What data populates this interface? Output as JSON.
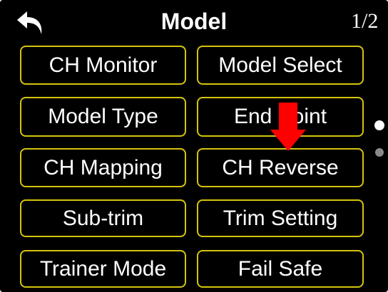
{
  "header": {
    "title": "Model",
    "page_indicator": "1/2",
    "back_icon": "back-arrow-icon"
  },
  "menu": {
    "items": [
      {
        "label": "CH Monitor"
      },
      {
        "label": "Model Select"
      },
      {
        "label": "Model Type"
      },
      {
        "label": "End Point"
      },
      {
        "label": "CH Mapping"
      },
      {
        "label": "CH Reverse"
      },
      {
        "label": "Sub-trim"
      },
      {
        "label": "Trim Setting"
      },
      {
        "label": "Trainer Mode"
      },
      {
        "label": "Fail Safe"
      }
    ]
  },
  "pagination": {
    "current_page": 1,
    "total_pages": 2
  },
  "annotation": {
    "type": "red-down-arrow-icon",
    "target": "CH Reverse"
  },
  "colors": {
    "background": "#000000",
    "button_border": "#d4c40c",
    "text": "#ffffff",
    "annotation": "#ff0000",
    "dot_active": "#ffffff",
    "dot_inactive": "#8a8a8a"
  }
}
